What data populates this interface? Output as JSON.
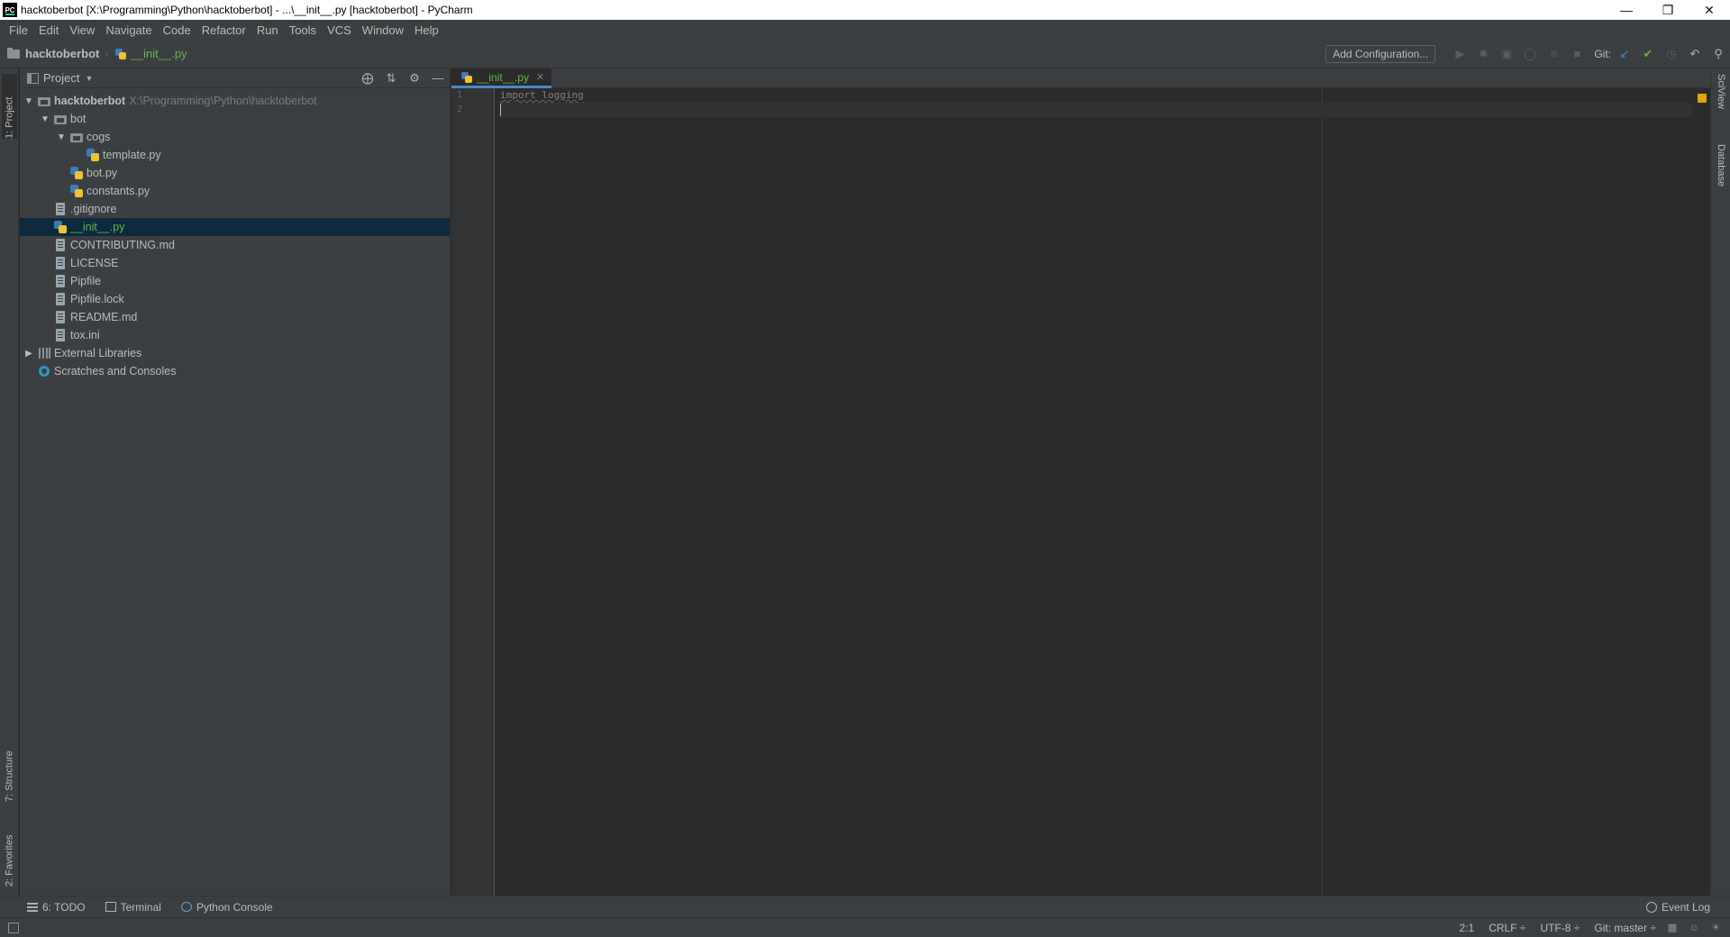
{
  "window": {
    "title": "hacktoberbot [X:\\Programming\\Python\\hacktoberbot] - ...\\__init__.py [hacktoberbot] - PyCharm",
    "app_icon_label": "PC"
  },
  "menu": {
    "items": [
      {
        "label": "File"
      },
      {
        "label": "Edit"
      },
      {
        "label": "View"
      },
      {
        "label": "Navigate"
      },
      {
        "label": "Code"
      },
      {
        "label": "Refactor"
      },
      {
        "label": "Run"
      },
      {
        "label": "Tools"
      },
      {
        "label": "VCS"
      },
      {
        "label": "Window"
      },
      {
        "label": "Help"
      }
    ]
  },
  "navbar": {
    "project": "hacktoberbot",
    "file": "__init__.py",
    "add_configuration": "Add Configuration...",
    "git_label": "Git:"
  },
  "left_strip": {
    "project_tab": "1: Project",
    "structure_tab": "7: Structure",
    "favorites_tab": "2: Favorites"
  },
  "right_strip": {
    "sciview_tab": "SciView",
    "database_tab": "Database"
  },
  "project_panel": {
    "title": "Project",
    "tree": [
      {
        "name": "hacktoberbot",
        "path": "X:\\Programming\\Python\\hacktoberbot"
      },
      {
        "name": "bot"
      },
      {
        "name": "cogs"
      },
      {
        "name": "template.py"
      },
      {
        "name": "bot.py"
      },
      {
        "name": "constants.py"
      },
      {
        "name": ".gitignore"
      },
      {
        "name": "__init__.py"
      },
      {
        "name": "CONTRIBUTING.md"
      },
      {
        "name": "LICENSE"
      },
      {
        "name": "Pipfile"
      },
      {
        "name": "Pipfile.lock"
      },
      {
        "name": "README.md"
      },
      {
        "name": "tox.ini"
      },
      {
        "name": "External Libraries"
      },
      {
        "name": "Scratches and Consoles"
      }
    ]
  },
  "editor": {
    "tab_label": "__init__.py",
    "line_numbers": [
      "1",
      "2"
    ],
    "lines": [
      "import logging",
      ""
    ]
  },
  "bottom_tools": {
    "todo": "6: TODO",
    "terminal": "Terminal",
    "python_console": "Python Console",
    "event_log": "Event Log"
  },
  "status": {
    "position": "2:1",
    "line_separator": "CRLF ÷",
    "encoding": "UTF-8 ÷",
    "git_branch": "Git: master ÷"
  },
  "colors": {
    "accent": "#4a88c7",
    "modified_file": "#62b543",
    "selection": "#0d293e",
    "warning_marker": "#e0a800"
  }
}
